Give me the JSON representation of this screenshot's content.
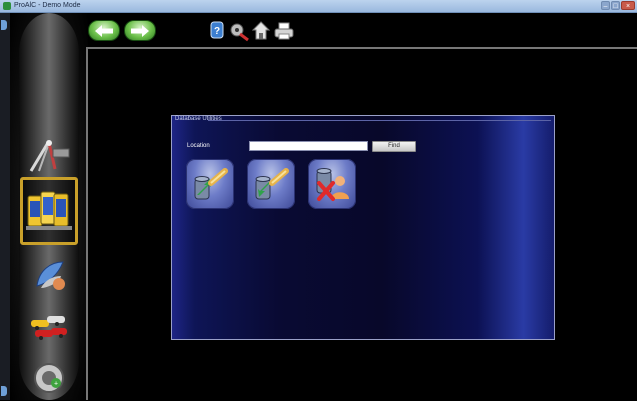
{
  "window": {
    "title": "ProAlC - Demo Mode",
    "minimize": "–",
    "maximize": "□",
    "close": "×"
  },
  "toolbar": {
    "back": "back-arrow-icon",
    "forward": "forward-arrow-icon",
    "tools": [
      "help-icon",
      "tools-icon",
      "house-icon",
      "printer-icon"
    ]
  },
  "sidebar": {
    "items": [
      {
        "name": "alignment-icon",
        "selected": false
      },
      {
        "name": "database-icon",
        "selected": true
      },
      {
        "name": "tire-icon",
        "selected": false
      },
      {
        "name": "vehicles-icon",
        "selected": false
      },
      {
        "name": "settings-icon",
        "selected": false
      }
    ]
  },
  "panel": {
    "title": "Database Utilities",
    "location_label": "Location",
    "location_value": "",
    "find_label": "Find",
    "buttons": [
      {
        "name": "export-database-icon"
      },
      {
        "name": "import-database-icon"
      },
      {
        "name": "delete-customer-icon"
      }
    ]
  },
  "colors": {
    "accent": "#6cc04a",
    "selection": "#c9a02a",
    "panel_edge": "#2a3ba5",
    "panel_dark": "#08082a",
    "delete_red": "#e02a2a"
  }
}
